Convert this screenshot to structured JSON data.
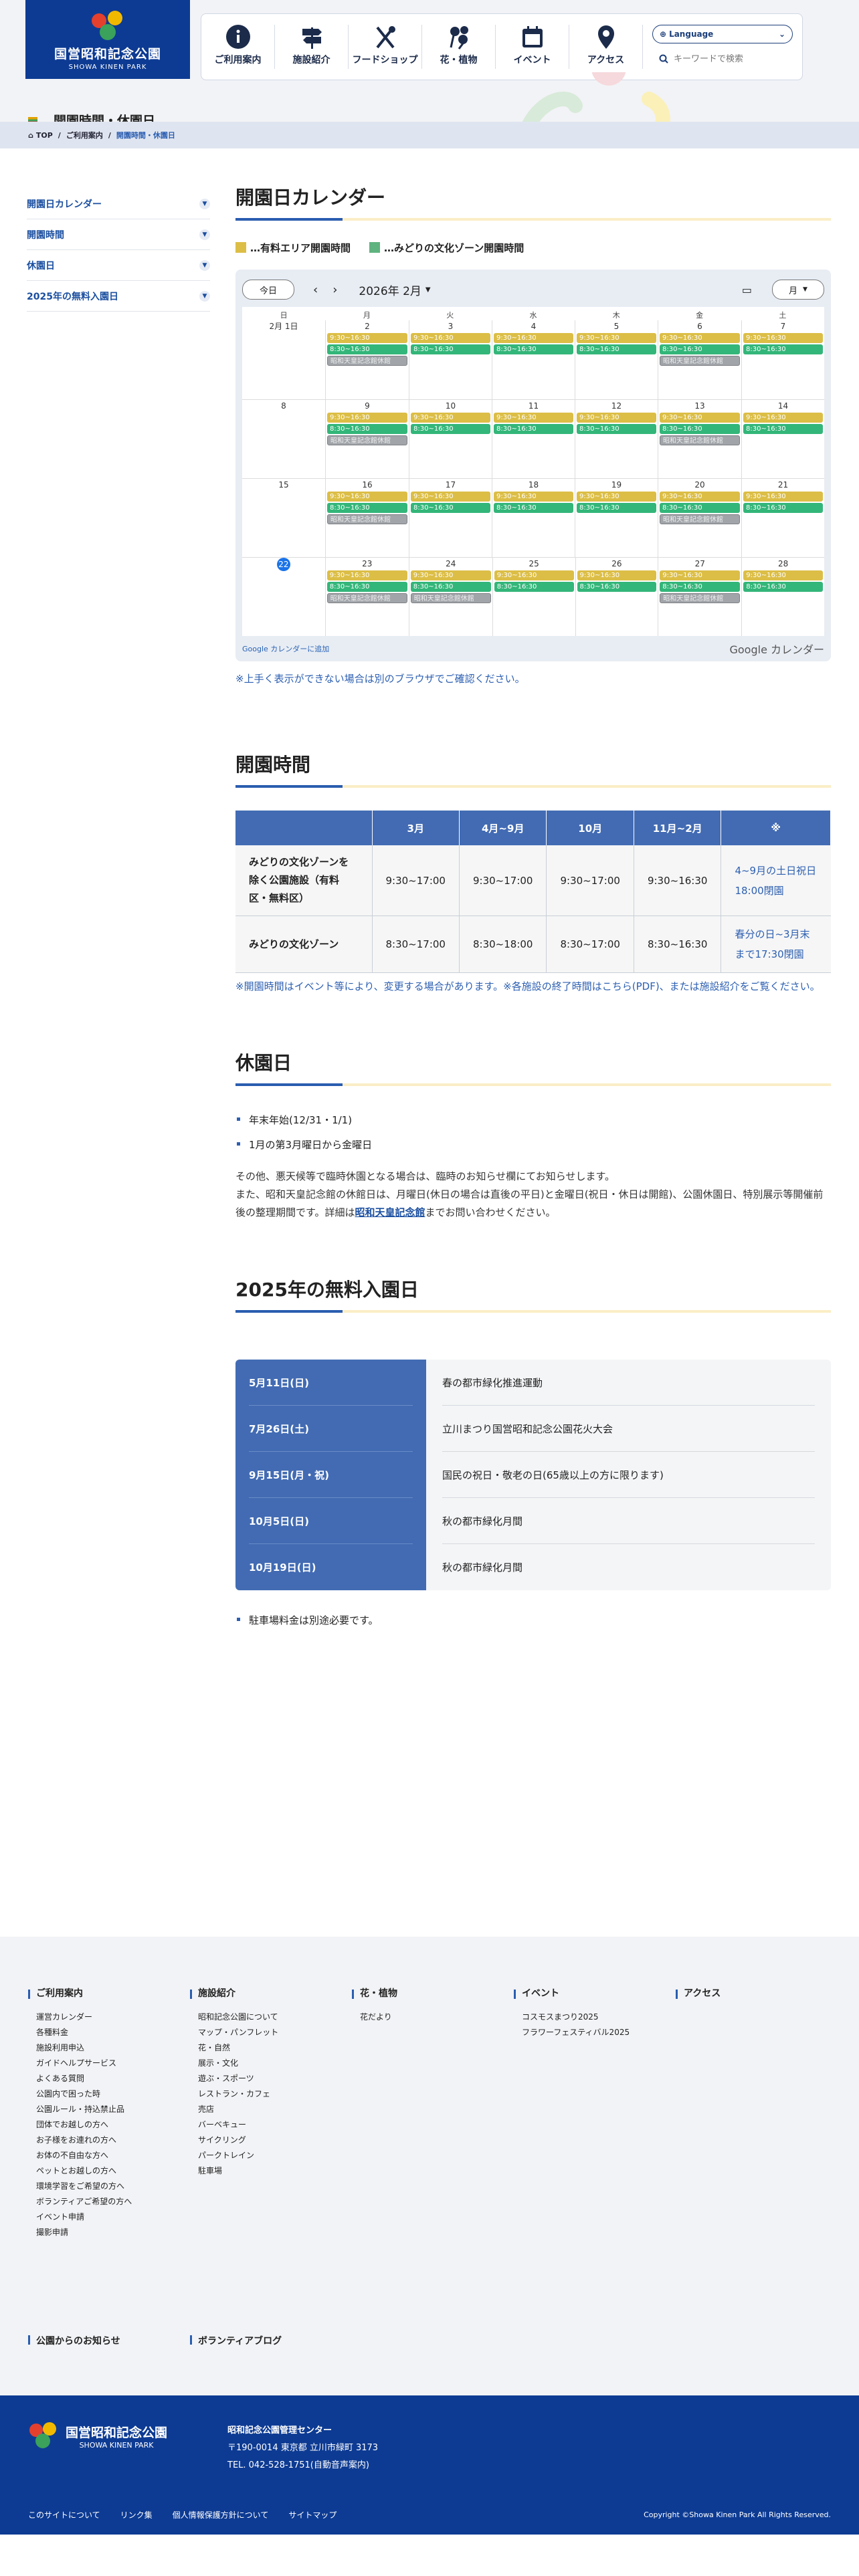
{
  "header": {
    "logo_jp": "国営昭和記念公園",
    "logo_en": "SHOWA KINEN PARK",
    "nav": [
      {
        "label": "ご利用案内",
        "icon": "info-icon"
      },
      {
        "label": "施設紹介",
        "icon": "signpost-icon"
      },
      {
        "label": "フードショップ",
        "icon": "cutlery-icon"
      },
      {
        "label": "花・植物",
        "icon": "flower-icon"
      },
      {
        "label": "イベント",
        "icon": "calendar-icon"
      },
      {
        "label": "アクセス",
        "icon": "map-pin-icon"
      }
    ],
    "language": "Language",
    "search_placeholder": "キーワードで検索"
  },
  "page_title": "開園時間・休園日",
  "breadcrumb": [
    "TOP",
    "ご利用案内",
    "開園時間・休園日"
  ],
  "sidebar": [
    "開園日カレンダー",
    "開園時間",
    "休園日",
    "2025年の無料入園日"
  ],
  "calendar": {
    "title": "開園日カレンダー",
    "legend_paid": "…有料エリア開園時間",
    "legend_midori": "…みどりの文化ゾーン開園時間",
    "today": "今日",
    "month": "2026年 2月",
    "view": "月",
    "dows": [
      "日",
      "月",
      "火",
      "水",
      "木",
      "金",
      "土"
    ],
    "weeks": [
      [
        "2月 1日",
        "2",
        "3",
        "4",
        "5",
        "6",
        "7"
      ],
      [
        "8",
        "9",
        "10",
        "11",
        "12",
        "13",
        "14"
      ],
      [
        "15",
        "16",
        "17",
        "18",
        "19",
        "20",
        "21"
      ],
      [
        "22",
        "23",
        "24",
        "25",
        "26",
        "27",
        "28"
      ]
    ],
    "ev_paid": "9:30~16:30",
    "ev_midori": "8:30~16:30",
    "ev_closed": "昭和天皇記念館休館",
    "gcal_add": "Google カレンダーに追加",
    "gcal_logo": "Google カレンダー",
    "note": "※上手く表示ができない場合は別のブラウザでご確認ください。",
    "colors": {
      "paid": "#dcbe46",
      "midori": "#33b679",
      "closed": "#a1a5aa"
    }
  },
  "hours": {
    "title": "開園時間",
    "headers": [
      "",
      "3月",
      "4月~9月",
      "10月",
      "11月~2月",
      "※"
    ],
    "rows": [
      {
        "label": "みどりの文化ゾーンを除く公園施設（有料区・無料区）",
        "cells": [
          "9:30~17:00",
          "9:30~17:00",
          "9:30~17:00",
          "9:30~16:30"
        ],
        "note": "4~9月の土日祝日18:00閉園"
      },
      {
        "label": "みどりの文化ゾーン",
        "cells": [
          "8:30~17:00",
          "8:30~18:00",
          "8:30~17:00",
          "8:30~16:30"
        ],
        "note": "春分の日~3月末まで17:30閉園"
      }
    ],
    "note": "※開園時間はイベント等により、変更する場合があります。※各施設の終了時間はこちら(PDF)、または施設紹介をご覧ください。"
  },
  "closed": {
    "title": "休園日",
    "items": [
      "年末年始(12/31・1/1)",
      "1月の第3月曜日から金曜日"
    ],
    "text1": "その他、悪天候等で臨時休園となる場合は、臨時のお知らせ欄にてお知らせします。",
    "text2": "また、昭和天皇記念館の休館日は、月曜日(休日の場合は直後の平日)と金曜日(祝日・休日は開館)、公園休園日、特別展示等開催前後の整理期間です。詳細は",
    "link": "昭和天皇記念館",
    "text3": "までお問い合わせください。"
  },
  "free": {
    "title": "2025年の無料入園日",
    "days": [
      {
        "date": "5月11日(日)",
        "event": "春の都市緑化推進運動"
      },
      {
        "date": "7月26日(土)",
        "event": "立川まつり国営昭和記念公園花火大会"
      },
      {
        "date": "9月15日(月・祝)",
        "event": "国民の祝日・敬老の日(65歳以上の方に限ります)"
      },
      {
        "date": "10月5日(日)",
        "event": "秋の都市緑化月間"
      },
      {
        "date": "10月19日(日)",
        "event": "秋の都市緑化月間"
      }
    ],
    "note": "駐車場料金は別途必要です。"
  },
  "footer": {
    "cols": [
      {
        "h": "ご利用案内",
        "items": [
          "運営カレンダー",
          "各種料金",
          "施設利用申込",
          "ガイドヘルプサービス",
          "よくある質問",
          "公園内で困った時",
          "公園ルール・持込禁止品",
          "団体でお越しの方へ",
          "お子様をお連れの方へ",
          "お体の不自由な方へ",
          "ペットとお越しの方へ",
          "環境学習をご希望の方へ",
          "ボランティアご希望の方へ",
          "イベント申請",
          "撮影申請"
        ]
      },
      {
        "h": "施設紹介",
        "items": [
          "昭和記念公園について",
          "マップ・パンフレット",
          "花・自然",
          "展示・文化",
          "遊ぶ・スポーツ",
          "レストラン・カフェ",
          "売店",
          "バーベキュー",
          "サイクリング",
          "パークトレイン",
          "駐車場"
        ]
      },
      {
        "h": "花・植物",
        "items": [
          "花だより"
        ]
      },
      {
        "h": "イベント",
        "items": [
          "コスモスまつり2025",
          "フラワーフェスティバル2025"
        ]
      },
      {
        "h": "アクセス",
        "items": []
      }
    ],
    "extra": [
      "公園からのお知らせ",
      "ボランティアブログ"
    ],
    "org": "昭和記念公園管理センター",
    "addr": "〒190-0014 東京都 立川市緑町 3173",
    "tel": "TEL. 042-528-1751(自動音声案内)",
    "links": [
      "このサイトについて",
      "リンク集",
      "個人情報保護方針について",
      "サイトマップ"
    ],
    "copyright": "Copyright ©Showa Kinen Park All Rights Reserved."
  }
}
